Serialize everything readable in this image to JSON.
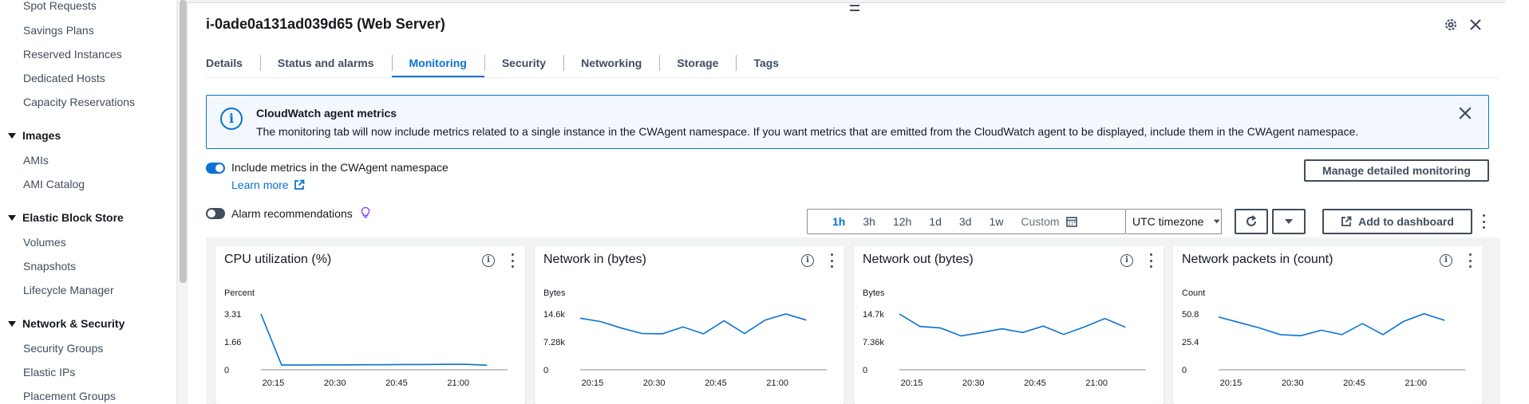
{
  "sidebar": {
    "links_top": [
      "Spot Requests",
      "Savings Plans",
      "Reserved Instances",
      "Dedicated Hosts",
      "Capacity Reservations"
    ],
    "sections": [
      {
        "title": "Images",
        "items": [
          "AMIs",
          "AMI Catalog"
        ]
      },
      {
        "title": "Elastic Block Store",
        "items": [
          "Volumes",
          "Snapshots",
          "Lifecycle Manager"
        ]
      },
      {
        "title": "Network & Security",
        "items": [
          "Security Groups",
          "Elastic IPs",
          "Placement Groups"
        ]
      }
    ]
  },
  "panel": {
    "title": "i-0ade0a131ad039d65 (Web Server)",
    "tabs": [
      "Details",
      "Status and alarms",
      "Monitoring",
      "Security",
      "Networking",
      "Storage",
      "Tags"
    ],
    "active_tab": "Monitoring"
  },
  "banner": {
    "title": "CloudWatch agent metrics",
    "text": "The monitoring tab will now include metrics related to a single instance in the CWAgent namespace. If you want metrics that are emitted from the CloudWatch agent to be displayed, include them in the CWAgent namespace."
  },
  "controls": {
    "cwagent_toggle_label": "Include metrics in the CWAgent namespace",
    "cwagent_toggle_on": true,
    "learn_more": "Learn more",
    "alarm_toggle_label": "Alarm recommendations",
    "alarm_toggle_on": false,
    "manage_button": "Manage detailed monitoring",
    "ranges": [
      "1h",
      "3h",
      "12h",
      "1d",
      "3d",
      "1w"
    ],
    "active_range": "1h",
    "custom_label": "Custom",
    "timezone": "UTC timezone",
    "add_dashboard": "Add to dashboard"
  },
  "colors": {
    "accent": "#0972d3",
    "line": "#0972d3"
  },
  "chart_data": [
    {
      "type": "line",
      "title": "CPU utilization (%)",
      "ylabel": "Percent",
      "yticks": [
        "3.31",
        "1.66",
        "0"
      ],
      "ylim": [
        0,
        3.31
      ],
      "xticks": [
        "20:15",
        "20:30",
        "20:45",
        "21:00"
      ],
      "x": [
        "20:12",
        "20:17",
        "20:22",
        "20:27",
        "20:32",
        "20:37",
        "20:42",
        "20:47",
        "20:52",
        "20:57",
        "21:02",
        "21:07"
      ],
      "series": [
        {
          "values": [
            3.31,
            0.28,
            0.28,
            0.29,
            0.29,
            0.3,
            0.3,
            0.31,
            0.31,
            0.32,
            0.32,
            0.27
          ]
        }
      ]
    },
    {
      "type": "line",
      "title": "Network in (bytes)",
      "ylabel": "Bytes",
      "yticks": [
        "14.6k",
        "7.28k",
        "0"
      ],
      "ylim": [
        0,
        14600
      ],
      "xticks": [
        "20:15",
        "20:30",
        "20:45",
        "21:00"
      ],
      "x": [
        "20:12",
        "20:17",
        "20:22",
        "20:27",
        "20:32",
        "20:37",
        "20:42",
        "20:47",
        "20:52",
        "20:57",
        "21:02",
        "21:07"
      ],
      "series": [
        {
          "values": [
            13500,
            12600,
            10900,
            9500,
            9400,
            11200,
            9400,
            12800,
            9500,
            13000,
            14600,
            13000
          ]
        }
      ]
    },
    {
      "type": "line",
      "title": "Network out (bytes)",
      "ylabel": "Bytes",
      "yticks": [
        "14.7k",
        "7.36k",
        "0"
      ],
      "ylim": [
        0,
        14700
      ],
      "xticks": [
        "20:15",
        "20:30",
        "20:45",
        "21:00"
      ],
      "x": [
        "20:12",
        "20:17",
        "20:22",
        "20:27",
        "20:32",
        "20:37",
        "20:42",
        "20:47",
        "20:52",
        "20:57",
        "21:02",
        "21:07"
      ],
      "series": [
        {
          "values": [
            14700,
            11400,
            11000,
            8900,
            9800,
            10800,
            9800,
            11500,
            9300,
            11300,
            13500,
            11200
          ]
        }
      ]
    },
    {
      "type": "line",
      "title": "Network packets in (count)",
      "ylabel": "Count",
      "yticks": [
        "50.8",
        "25.4",
        "0"
      ],
      "ylim": [
        0,
        50.8
      ],
      "xticks": [
        "20:15",
        "20:30",
        "20:45",
        "21:00"
      ],
      "x": [
        "20:12",
        "20:17",
        "20:22",
        "20:27",
        "20:32",
        "20:37",
        "20:42",
        "20:47",
        "20:52",
        "20:57",
        "21:02",
        "21:07"
      ],
      "series": [
        {
          "values": [
            48,
            43,
            38,
            32,
            31,
            36,
            32,
            42,
            32,
            44,
            51,
            45
          ]
        }
      ]
    }
  ]
}
